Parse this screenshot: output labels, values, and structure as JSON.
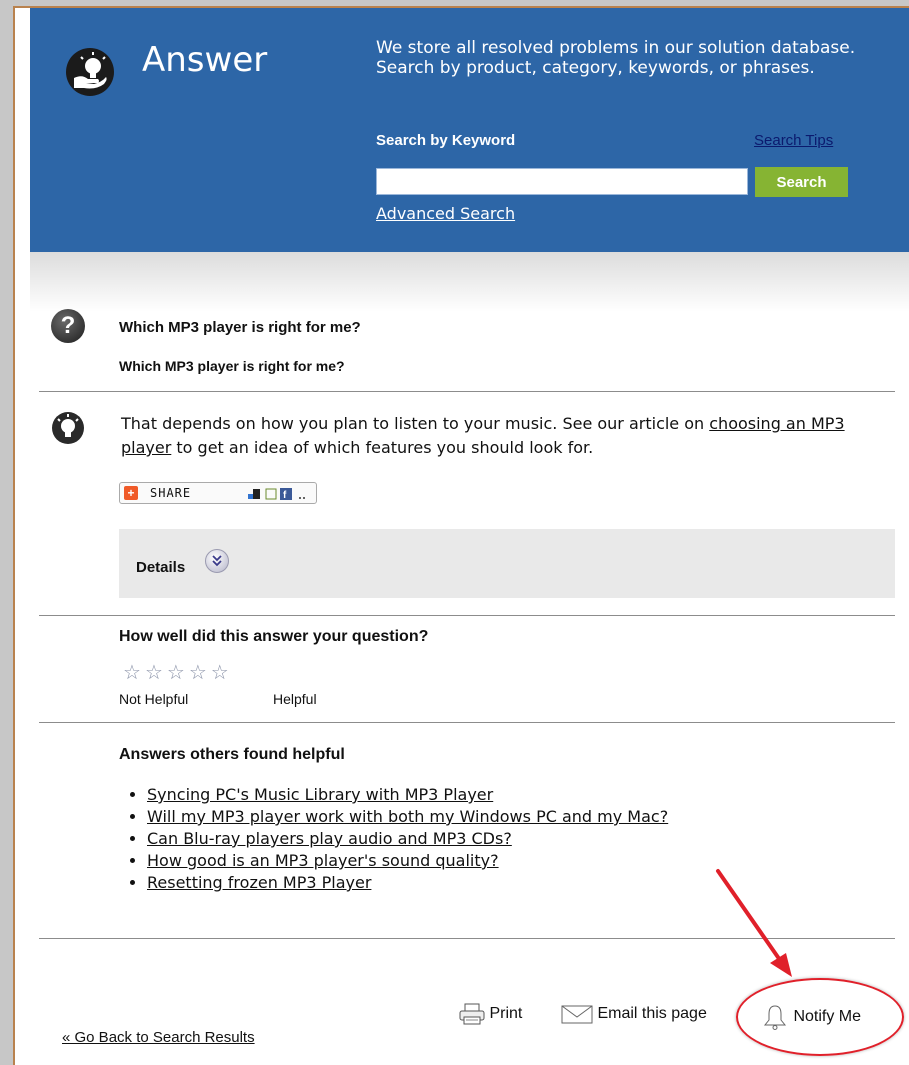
{
  "header": {
    "title": "Answer",
    "description": "We store all resolved problems in our solution database. Search by product, category, keywords, or phrases.",
    "search_label": "Search by Keyword",
    "search_tips": "Search Tips",
    "search_value": "",
    "search_button": "Search",
    "advanced_search": "Advanced Search"
  },
  "question": {
    "title": "Which MP3 player is right for me?",
    "subtitle": "Which MP3 player is right for me?"
  },
  "answer": {
    "text_before": "That depends on how you plan to listen to your music. See our article on ",
    "link": "choosing an MP3 player",
    "text_after": " to get an idea of which features you should look for."
  },
  "share": {
    "label": "SHARE"
  },
  "details": {
    "label": "Details"
  },
  "rating": {
    "question": "How well did this answer your question?",
    "low_label": "Not Helpful",
    "high_label": "Helpful",
    "stars_total": 5,
    "stars_selected": 0
  },
  "related": {
    "title": "Answers others found helpful",
    "items": [
      "Syncing PC's Music Library with MP3 Player",
      "Will my MP3 player work with both my Windows PC and my Mac?",
      "Can Blu-ray players play audio and MP3 CDs?",
      "How good is an MP3 player's sound quality?",
      "Resetting frozen MP3 Player"
    ]
  },
  "footer": {
    "back": "« Go Back to Search Results",
    "print": "Print",
    "email": "Email this page",
    "notify": "Notify Me"
  },
  "colors": {
    "header_bg": "#2d66a7",
    "search_button": "#86b433",
    "highlight": "#e0202a"
  },
  "icons": [
    "lightbulb-hand-icon",
    "question-icon",
    "lightbulb-icon",
    "share-plus-icon",
    "details-chevron-icon",
    "star-icon",
    "printer-icon",
    "envelope-icon",
    "bell-icon",
    "annotation-arrow"
  ]
}
